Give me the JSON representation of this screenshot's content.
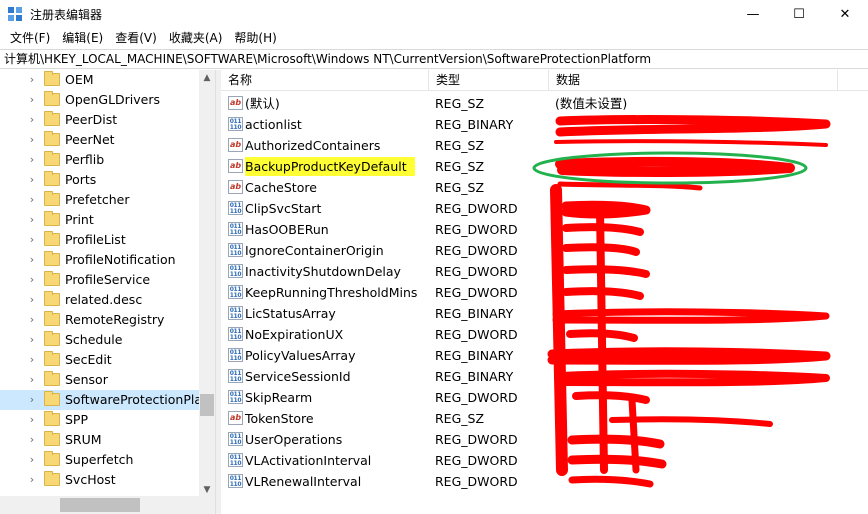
{
  "window": {
    "title": "注册表编辑器",
    "minimize": "—",
    "maximize": "☐",
    "close": "✕"
  },
  "menu": [
    "文件(F)",
    "编辑(E)",
    "查看(V)",
    "收藏夹(A)",
    "帮助(H)"
  ],
  "address": "计算机\\HKEY_LOCAL_MACHINE\\SOFTWARE\\Microsoft\\Windows NT\\CurrentVersion\\SoftwareProtectionPlatform",
  "tree": {
    "items": [
      {
        "label": "OEM",
        "selected": false
      },
      {
        "label": "OpenGLDrivers",
        "selected": false
      },
      {
        "label": "PeerDist",
        "selected": false
      },
      {
        "label": "PeerNet",
        "selected": false
      },
      {
        "label": "Perflib",
        "selected": false
      },
      {
        "label": "Ports",
        "selected": false
      },
      {
        "label": "Prefetcher",
        "selected": false
      },
      {
        "label": "Print",
        "selected": false
      },
      {
        "label": "ProfileList",
        "selected": false
      },
      {
        "label": "ProfileNotification",
        "selected": false
      },
      {
        "label": "ProfileService",
        "selected": false
      },
      {
        "label": "related.desc",
        "selected": false
      },
      {
        "label": "RemoteRegistry",
        "selected": false
      },
      {
        "label": "Schedule",
        "selected": false
      },
      {
        "label": "SecEdit",
        "selected": false
      },
      {
        "label": "Sensor",
        "selected": false
      },
      {
        "label": "SoftwareProtectionPlatf",
        "selected": true
      },
      {
        "label": "SPP",
        "selected": false
      },
      {
        "label": "SRUM",
        "selected": false
      },
      {
        "label": "Superfetch",
        "selected": false
      },
      {
        "label": "SvcHost",
        "selected": false
      }
    ]
  },
  "columns": {
    "name": "名称",
    "type": "类型",
    "data": "数据"
  },
  "values": [
    {
      "name": "(默认)",
      "type": "REG_SZ",
      "data": "(数值未设置)",
      "icon": "string-value-icon",
      "highlight": false
    },
    {
      "name": "actionlist",
      "type": "REG_BINARY",
      "data": "",
      "icon": "binary-value-icon",
      "highlight": false
    },
    {
      "name": "AuthorizedContainers",
      "type": "REG_SZ",
      "data": "",
      "icon": "string-value-icon",
      "highlight": false
    },
    {
      "name": "BackupProductKeyDefault",
      "type": "REG_SZ",
      "data": "",
      "icon": "string-value-icon",
      "highlight": true
    },
    {
      "name": "CacheStore",
      "type": "REG_SZ",
      "data": "",
      "icon": "string-value-icon",
      "highlight": false
    },
    {
      "name": "ClipSvcStart",
      "type": "REG_DWORD",
      "data": "",
      "icon": "binary-value-icon",
      "highlight": false
    },
    {
      "name": "HasOOBERun",
      "type": "REG_DWORD",
      "data": "",
      "icon": "binary-value-icon",
      "highlight": false
    },
    {
      "name": "IgnoreContainerOrigin",
      "type": "REG_DWORD",
      "data": "",
      "icon": "binary-value-icon",
      "highlight": false
    },
    {
      "name": "InactivityShutdownDelay",
      "type": "REG_DWORD",
      "data": "",
      "icon": "binary-value-icon",
      "highlight": false
    },
    {
      "name": "KeepRunningThresholdMins",
      "type": "REG_DWORD",
      "data": "",
      "icon": "binary-value-icon",
      "highlight": false
    },
    {
      "name": "LicStatusArray",
      "type": "REG_BINARY",
      "data": "",
      "icon": "binary-value-icon",
      "highlight": false
    },
    {
      "name": "NoExpirationUX",
      "type": "REG_DWORD",
      "data": "",
      "icon": "binary-value-icon",
      "highlight": false
    },
    {
      "name": "PolicyValuesArray",
      "type": "REG_BINARY",
      "data": "",
      "icon": "binary-value-icon",
      "highlight": false
    },
    {
      "name": "ServiceSessionId",
      "type": "REG_BINARY",
      "data": "",
      "icon": "binary-value-icon",
      "highlight": false
    },
    {
      "name": "SkipRearm",
      "type": "REG_DWORD",
      "data": "",
      "icon": "binary-value-icon",
      "highlight": false
    },
    {
      "name": "TokenStore",
      "type": "REG_SZ",
      "data": "",
      "icon": "string-value-icon",
      "highlight": false
    },
    {
      "name": "UserOperations",
      "type": "REG_DWORD",
      "data": "",
      "icon": "binary-value-icon",
      "highlight": false
    },
    {
      "name": "VLActivationInterval",
      "type": "REG_DWORD",
      "data": "",
      "icon": "binary-value-icon",
      "highlight": false
    },
    {
      "name": "VLRenewalInterval",
      "type": "REG_DWORD",
      "data": "",
      "icon": "binary-value-icon",
      "highlight": false
    }
  ],
  "colors": {
    "highlight": "#ffff33",
    "redaction": "#ff0000",
    "ellipse": "#22b14c",
    "selection": "#cce8ff"
  }
}
